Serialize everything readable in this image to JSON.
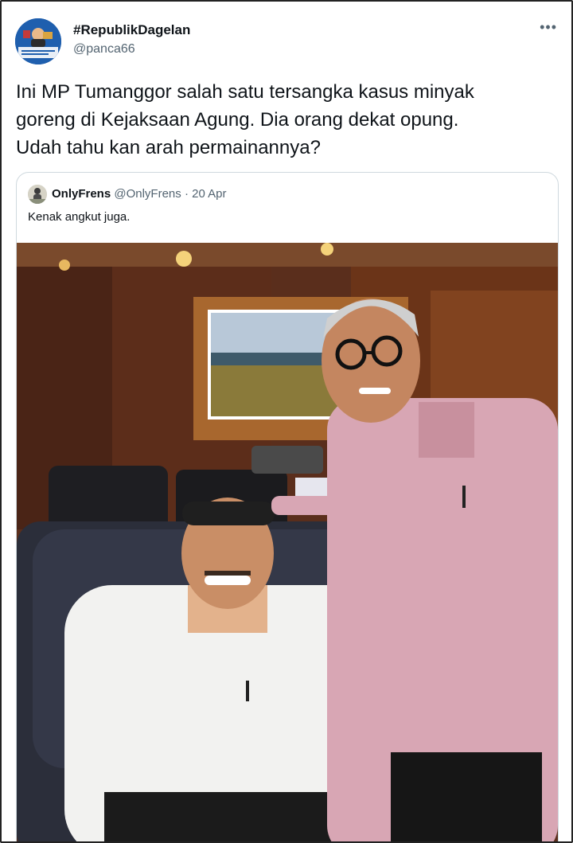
{
  "author": {
    "display_name": "#RepublikDagelan",
    "handle": "@panca66",
    "avatar_icon": "profile-avatar-icon"
  },
  "more_icon": "more-options-icon",
  "tweet": {
    "text": "Ini MP Tumanggor salah satu tersangka kasus minyak\ngoreng di Kejaksaan Agung. Dia orang dekat opung.\nUdah tahu kan arah permainannya?"
  },
  "quoted": {
    "display_name": "OnlyFrens",
    "handle": "@OnlyFrens",
    "separator": "·",
    "date": "20 Apr",
    "text": "Kenak angkut juga.",
    "media": "photo of two men in an office"
  },
  "colors": {
    "text_primary": "#0f1419",
    "text_secondary": "#536471",
    "border": "#cfd9de"
  }
}
